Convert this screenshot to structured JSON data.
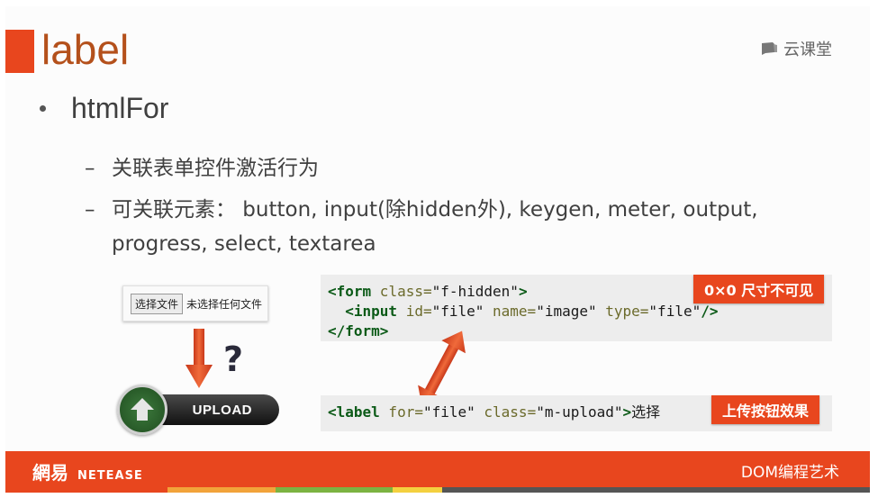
{
  "slide": {
    "title": "label",
    "brand": "云课堂",
    "bullet": "htmlFor",
    "sub_items": [
      "关联表单控件激活行为",
      "可关联元素： button, input(除hidden外), keygen, meter, output,",
      "progress, select, textarea"
    ]
  },
  "illustration": {
    "file_button": "选择文件",
    "file_status": "未选择任何文件",
    "question": "?",
    "upload_label": "UPLOAD"
  },
  "code1": {
    "line1": {
      "t1": "<form",
      "a1": " class=",
      "s1": "\"f-hidden\"",
      "t2": ">"
    },
    "line2": {
      "indent": "  ",
      "t1": "<input",
      "a1": " id=",
      "s1": "\"file\"",
      "a2": " name=",
      "s2": "\"image\"",
      "a3": " type=",
      "s3": "\"file\"",
      "t2": "/>"
    },
    "line3": {
      "t1": "</form>"
    }
  },
  "code2": {
    "t1": "<label",
    "a1": " for=",
    "s1": "\"file\"",
    "a2": " class=",
    "s2": "\"m-upload\"",
    "t2": ">",
    "text": "选择"
  },
  "badges": {
    "hidden": "0×0 尺寸不可见",
    "effect": "上传按钮效果"
  },
  "footer": {
    "logo_cn": "網易",
    "logo_en": "NETEASE",
    "course": "DOM编程艺术"
  },
  "colors": {
    "accent": "#e8461e",
    "title": "#b4501b",
    "tag": "#0b5a17"
  }
}
